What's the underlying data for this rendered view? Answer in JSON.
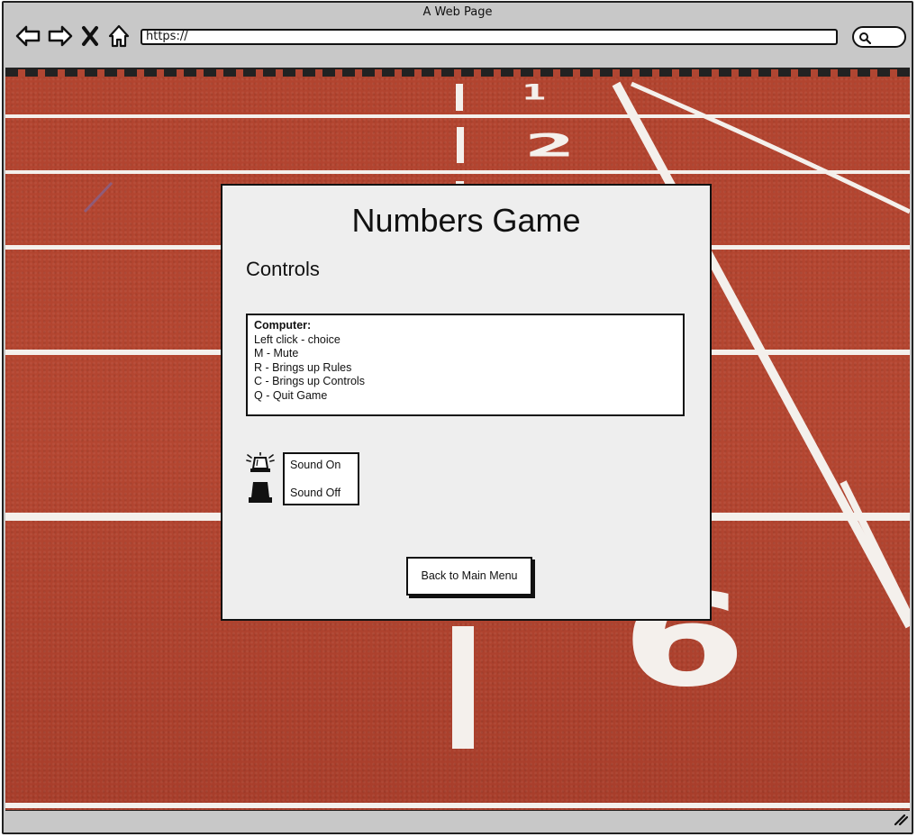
{
  "browser": {
    "window_title": "A Web Page",
    "url": "https://",
    "icons": [
      "back-arrow-icon",
      "forward-arrow-icon",
      "close-icon",
      "home-icon",
      "search-icon",
      "resize-grip-icon"
    ]
  },
  "background": {
    "description_colors": {
      "track": "#b04632",
      "lane_lines": "#ffffff"
    },
    "lane_numbers": [
      "1",
      "2",
      "6"
    ]
  },
  "dialog": {
    "title": "Numbers Game",
    "subtitle": "Controls",
    "controls": {
      "heading": "Computer:",
      "items": [
        "Left click - choice",
        "M - Mute",
        "R - Brings up Rules",
        "C - Brings up Controls",
        "Q - Quit Game"
      ]
    },
    "sound": {
      "on_label": "Sound On",
      "off_label": "Sound Off",
      "icons": [
        "siren-on-icon",
        "siren-off-icon"
      ]
    },
    "back_button_label": "Back to Main Menu"
  }
}
